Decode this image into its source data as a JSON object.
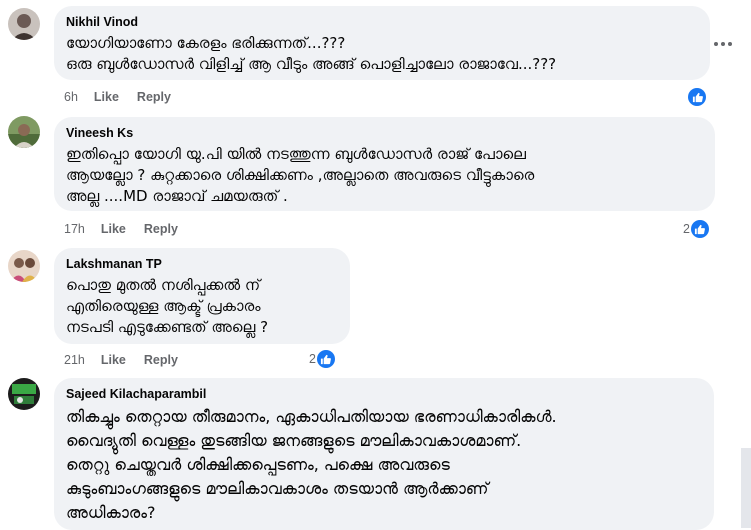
{
  "comments": [
    {
      "author": "Nikhil Vinod",
      "text": "യോഗിയാണോ കേരളം ഭരിക്കുന്നത്...???\nഒരു ബുൾഡോസർ വിളിച്ച് ആ വീടും അങ്ങ് പൊളിച്ചാലോ രാജാവേ...???",
      "time": "6h",
      "like": "Like",
      "reply": "Reply",
      "reaction_count": ""
    },
    {
      "author": "Vineesh Ks",
      "text": "ഇതിപ്പൊ യോഗി യു.പി യിൽ നടത്തുന്ന ബുൾഡോസർ രാജ് പോലെ\nആയല്ലോ ? കുറ്റക്കാരെ ശിക്ഷിക്കണം ,അല്ലാതെ അവരുടെ വീട്ടുകാരെ\nഅല്ല ....MD രാജാവ് ചമയരുത് .",
      "time": "17h",
      "like": "Like",
      "reply": "Reply",
      "reaction_count": "2"
    },
    {
      "author": "Lakshmanan TP",
      "text": "പൊതു മുതൽ നശിപ്പക്കൽ ന്\nഎതിരെയുള്ള ആക്ട് പ്രകാരം\nനടപടി എടുക്കേണ്ടത് അല്ലെ ?",
      "time": "21h",
      "like": "Like",
      "reply": "Reply",
      "reaction_count": "2"
    },
    {
      "author": "Sajeed Kilachaparambil",
      "text": "തികച്ചും തെറ്റായ തീരുമാനം, ഏകാധിപതിയായ ഭരണാധികാരികൾ.\nവൈദ്യുതി വെള്ളം തുടങ്ങിയ ജനങ്ങളുടെ മൗലികാവകാശമാണ്.\nതെറ്റു ചെയ്തവർ ശിക്ഷിക്കപ്പെടണം, പക്ഷെ അവരുടെ\nകുടുംബാംഗങ്ങളുടെ മൗലികാവകാശം തടയാൻ ആർക്കാണ്\nഅധികാരം?",
      "time": "",
      "like": "",
      "reply": "",
      "reaction_count": ""
    }
  ],
  "icons": {
    "like_reaction": "thumbs-up-icon",
    "more": "more-options-icon"
  },
  "colors": {
    "bubble": "#f0f2f5",
    "like_blue": "#1877f2",
    "meta_gray": "#65676b"
  }
}
